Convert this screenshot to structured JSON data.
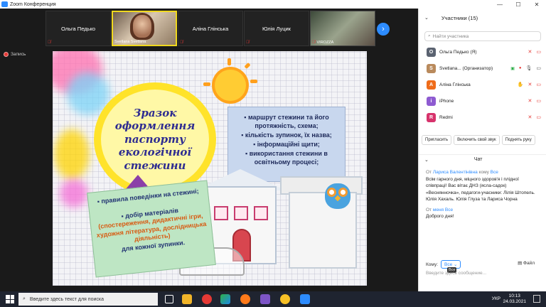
{
  "window": {
    "title": "Zoom Конференция",
    "controls": {
      "minimize": "—",
      "maximize": "☐",
      "close": "✕"
    }
  },
  "participants_strip": {
    "tiles": [
      {
        "name": "Ольга Педько",
        "has_video": false
      },
      {
        "name": "Svetlana Svetlana",
        "has_video": true,
        "active_speaker": true
      },
      {
        "name": "Аліна Глінська",
        "has_video": false
      },
      {
        "name": "Юлія Луцик",
        "has_video": false
      },
      {
        "name": "VIROZZA",
        "has_video": true
      }
    ],
    "next_icon": "chevron-right-icon"
  },
  "recording": {
    "label": "Запись"
  },
  "slide": {
    "title": "Зразок оформлення паспорту екологічної стежини",
    "box_blue": [
      "▪ маршрут стежини та його протяжність, схема;",
      "▪ кількість зупинок, їх назва;",
      "▪ інформаційні щити;",
      "▪ використання стежини в освітньому процесі;"
    ],
    "box_green": {
      "item1": "▪ правила поведінки на стежині;",
      "item2_head": "▪ добір матеріалів",
      "item2_orange": "(спостереження, дидактичні ігри, художня література, дослідницька діяльність)",
      "item2_tail": "для кожної зупинки."
    }
  },
  "panel": {
    "title": "Участники (15)",
    "search_placeholder": "Найти участника",
    "participants": [
      {
        "initial": "О",
        "name": "Ольга Педько (Я)",
        "color": "#5a6270"
      },
      {
        "initial": "S",
        "name": "Svetlana... (Организатор)",
        "color": "#b98a5c"
      },
      {
        "initial": "А",
        "name": "Аліна Глінська",
        "color": "#ef6c1a"
      },
      {
        "initial": "i",
        "name": "iPhone",
        "color": "#8e5bd1"
      },
      {
        "initial": "R",
        "name": "Redmi",
        "color": "#d7336c"
      }
    ],
    "buttons": {
      "invite": "Пригласить",
      "unmute_me": "Включить свой звук",
      "raise_hand": "Поднять руку"
    },
    "chat": {
      "title": "Чат",
      "messages": [
        {
          "from_prefix": "От",
          "from": "Лариса Валентінівна",
          "to_prefix": "кому",
          "to": "Все",
          "text": "Всім гарного дня, міцного здоров'я і плідної співпраці! Вас вітає ДНЗ (ясла-садок) «Веснянночка», педагоги-учасники: Лілія Штопель. Юлія Хахаль. Юлія Глуза та Лариса Чорна"
        },
        {
          "from_prefix": "От",
          "from": "меня",
          "to_prefix": "",
          "to": "Все",
          "text": "Доброго дня!"
        }
      ],
      "to_label": "Кому:",
      "to_value": "Все",
      "file_label": "Файл",
      "tooltip": "Все",
      "input_placeholder": "Введите здесь сообщение..."
    }
  },
  "taskbar": {
    "search_placeholder": "Введите здесь текст для поиска",
    "lang": "УКР",
    "time": "10:13",
    "date": "24.03.2021"
  }
}
